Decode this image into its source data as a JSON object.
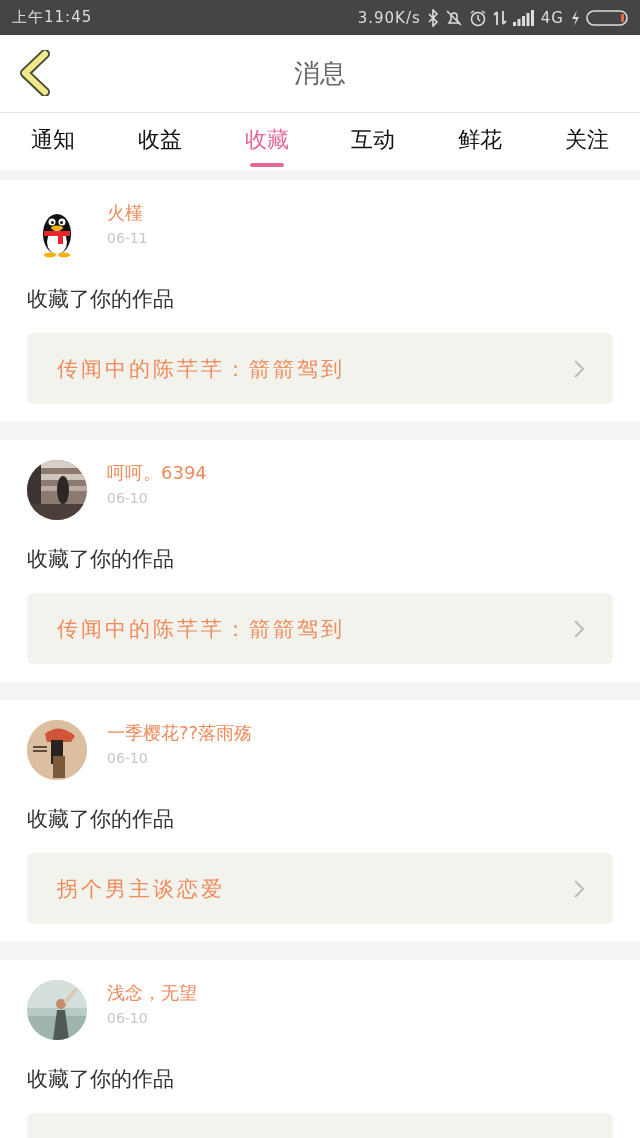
{
  "status_bar": {
    "time": "上午11:45",
    "speed": "3.90K/s",
    "network": "4G"
  },
  "header": {
    "title": "消息"
  },
  "tabs": [
    {
      "label": "通知",
      "selected": false
    },
    {
      "label": "收益",
      "selected": false
    },
    {
      "label": "收藏",
      "selected": true
    },
    {
      "label": "互动",
      "selected": false
    },
    {
      "label": "鲜花",
      "selected": false
    },
    {
      "label": "关注",
      "selected": false
    }
  ],
  "messages": [
    {
      "avatar": {
        "kind": "penguin"
      },
      "name": "火槿",
      "date": "06-11",
      "action": "收藏了你的作品",
      "work": "传闻中的陈芊芊：箭箭驾到"
    },
    {
      "name": "呵呵。6394",
      "date": "06-10",
      "action": "收藏了你的作品",
      "work": "传闻中的陈芊芊：箭箭驾到"
    },
    {
      "name": "一季樱花??落雨殇",
      "date": "06-10",
      "action": "收藏了你的作品",
      "work": "拐个男主谈恋爱"
    },
    {
      "name": "浅念，无望",
      "date": "06-10",
      "action": "收藏了你的作品"
    }
  ]
}
